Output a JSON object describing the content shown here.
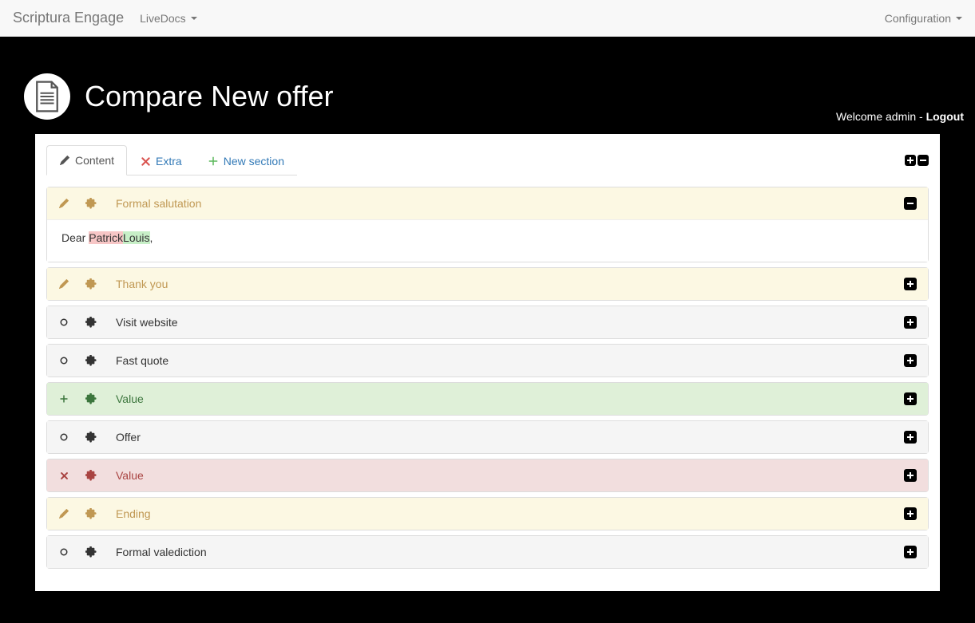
{
  "nav": {
    "brand": "Scriptura Engage",
    "livedocs": "LiveDocs",
    "configuration": "Configuration"
  },
  "header": {
    "title": "Compare New offer",
    "welcome": "Welcome admin - ",
    "logout": "Logout"
  },
  "tabs": {
    "content": "Content",
    "extra": "Extra",
    "new_section": "New section"
  },
  "salutation_body": {
    "prefix": "Dear ",
    "removed": "Patrick",
    "added": "Louis",
    "suffix": ","
  },
  "sections": [
    {
      "title": "Formal salutation",
      "status": "warn",
      "icon": "pencil",
      "expanded": true
    },
    {
      "title": "Thank you",
      "status": "warn",
      "icon": "pencil",
      "expanded": false
    },
    {
      "title": "Visit website",
      "status": "default",
      "icon": "circle",
      "expanded": false
    },
    {
      "title": "Fast quote",
      "status": "default",
      "icon": "circle",
      "expanded": false
    },
    {
      "title": "Value",
      "status": "success",
      "icon": "plus",
      "expanded": false
    },
    {
      "title": "Offer",
      "status": "default",
      "icon": "circle",
      "expanded": false
    },
    {
      "title": "Value",
      "status": "danger",
      "icon": "cross",
      "expanded": false
    },
    {
      "title": "Ending",
      "status": "warn",
      "icon": "pencil",
      "expanded": false
    },
    {
      "title": "Formal valediction",
      "status": "default",
      "icon": "circle",
      "expanded": false
    }
  ]
}
